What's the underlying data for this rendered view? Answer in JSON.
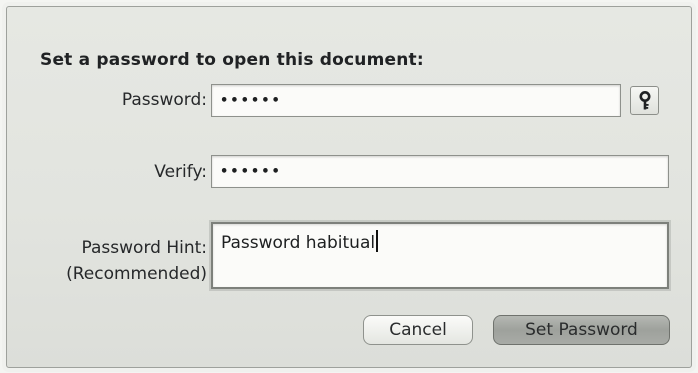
{
  "dialog": {
    "heading": "Set a password to open this document:",
    "password": {
      "label": "Password:",
      "value": "••••••"
    },
    "verify": {
      "label": "Verify:",
      "value": "••••••"
    },
    "hint": {
      "label_line1": "Password Hint:",
      "label_line2": "(Recommended)",
      "value": "Password habitual"
    },
    "key_button_icon": "key-icon",
    "cancel_label": "Cancel",
    "set_password_label": "Set Password"
  }
}
